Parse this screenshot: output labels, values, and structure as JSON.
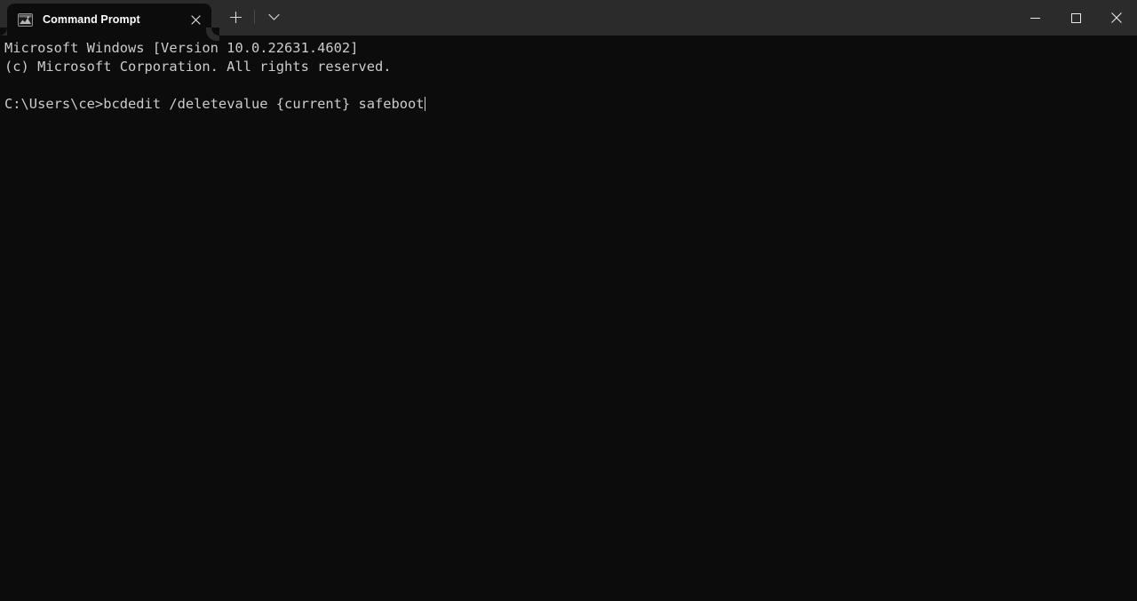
{
  "window": {
    "app_name": "Command Prompt",
    "titlebar_color": "#2b2b2b",
    "terminal_bg": "#0c0c0c",
    "terminal_fg": "#cccccc"
  },
  "tabs": [
    {
      "label": "Command Prompt",
      "icon": "console-window-icon",
      "close_label": "Close tab",
      "active": true
    }
  ],
  "tabstrip": {
    "new_tab_label": "New tab",
    "dropdown_label": "Open new tab dropdown"
  },
  "window_controls": {
    "minimize_label": "Minimize",
    "maximize_label": "Maximize",
    "close_label": "Close"
  },
  "terminal": {
    "lines": [
      "Microsoft Windows [Version 10.0.22631.4602]",
      "(c) Microsoft Corporation. All rights reserved.",
      ""
    ],
    "prompt": "C:\\Users\\ce>",
    "command": "bcdedit /deletevalue {current} safeboot",
    "cursor_visible": true
  }
}
